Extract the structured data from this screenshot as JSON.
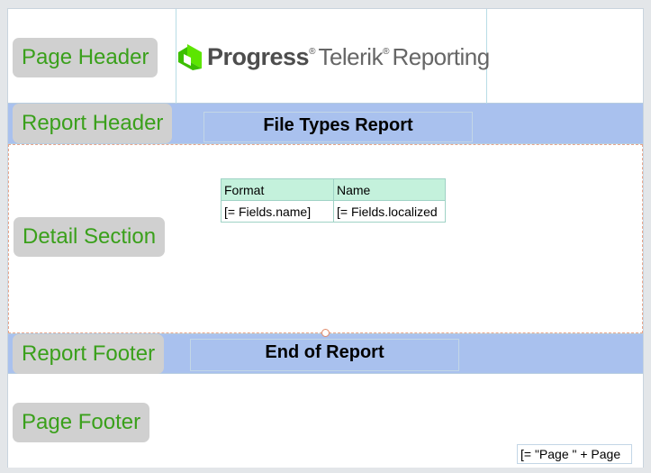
{
  "labels": {
    "page_header": "Page Header",
    "report_header": "Report Header",
    "detail_section": "Detail Section",
    "report_footer": "Report Footer",
    "page_footer": "Page Footer"
  },
  "logo": {
    "progress": "Progress",
    "reg1": "®",
    "telerik_reporting": "Telerik",
    "reg2": "®",
    "reporting": "Reporting"
  },
  "report_header": {
    "title": "File Types Report"
  },
  "table": {
    "columns": [
      "Format",
      "Name"
    ],
    "row": [
      "[= Fields.name]",
      "[= Fields.localized"
    ]
  },
  "report_footer": {
    "text": "End of Report"
  },
  "page_footer": {
    "expression": "[= \"Page \" + Page"
  },
  "colors": {
    "band_blue": "#a9c1ee",
    "label_green": "#3aa01b",
    "label_bg": "#d0d0d0",
    "table_header": "#c4f1dc",
    "brand_green": "#5ce500"
  }
}
